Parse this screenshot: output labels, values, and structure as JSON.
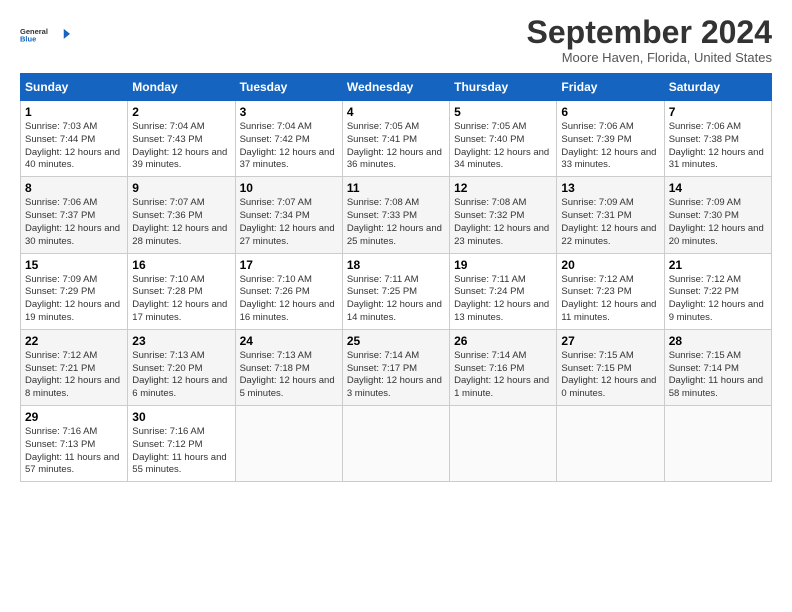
{
  "logo": {
    "line1": "General",
    "line2": "Blue"
  },
  "title": "September 2024",
  "location": "Moore Haven, Florida, United States",
  "weekdays": [
    "Sunday",
    "Monday",
    "Tuesday",
    "Wednesday",
    "Thursday",
    "Friday",
    "Saturday"
  ],
  "weeks": [
    [
      {
        "day": "1",
        "sunrise": "7:03 AM",
        "sunset": "7:44 PM",
        "daylight": "12 hours and 40 minutes."
      },
      {
        "day": "2",
        "sunrise": "7:04 AM",
        "sunset": "7:43 PM",
        "daylight": "12 hours and 39 minutes."
      },
      {
        "day": "3",
        "sunrise": "7:04 AM",
        "sunset": "7:42 PM",
        "daylight": "12 hours and 37 minutes."
      },
      {
        "day": "4",
        "sunrise": "7:05 AM",
        "sunset": "7:41 PM",
        "daylight": "12 hours and 36 minutes."
      },
      {
        "day": "5",
        "sunrise": "7:05 AM",
        "sunset": "7:40 PM",
        "daylight": "12 hours and 34 minutes."
      },
      {
        "day": "6",
        "sunrise": "7:06 AM",
        "sunset": "7:39 PM",
        "daylight": "12 hours and 33 minutes."
      },
      {
        "day": "7",
        "sunrise": "7:06 AM",
        "sunset": "7:38 PM",
        "daylight": "12 hours and 31 minutes."
      }
    ],
    [
      {
        "day": "8",
        "sunrise": "7:06 AM",
        "sunset": "7:37 PM",
        "daylight": "12 hours and 30 minutes."
      },
      {
        "day": "9",
        "sunrise": "7:07 AM",
        "sunset": "7:36 PM",
        "daylight": "12 hours and 28 minutes."
      },
      {
        "day": "10",
        "sunrise": "7:07 AM",
        "sunset": "7:34 PM",
        "daylight": "12 hours and 27 minutes."
      },
      {
        "day": "11",
        "sunrise": "7:08 AM",
        "sunset": "7:33 PM",
        "daylight": "12 hours and 25 minutes."
      },
      {
        "day": "12",
        "sunrise": "7:08 AM",
        "sunset": "7:32 PM",
        "daylight": "12 hours and 23 minutes."
      },
      {
        "day": "13",
        "sunrise": "7:09 AM",
        "sunset": "7:31 PM",
        "daylight": "12 hours and 22 minutes."
      },
      {
        "day": "14",
        "sunrise": "7:09 AM",
        "sunset": "7:30 PM",
        "daylight": "12 hours and 20 minutes."
      }
    ],
    [
      {
        "day": "15",
        "sunrise": "7:09 AM",
        "sunset": "7:29 PM",
        "daylight": "12 hours and 19 minutes."
      },
      {
        "day": "16",
        "sunrise": "7:10 AM",
        "sunset": "7:28 PM",
        "daylight": "12 hours and 17 minutes."
      },
      {
        "day": "17",
        "sunrise": "7:10 AM",
        "sunset": "7:26 PM",
        "daylight": "12 hours and 16 minutes."
      },
      {
        "day": "18",
        "sunrise": "7:11 AM",
        "sunset": "7:25 PM",
        "daylight": "12 hours and 14 minutes."
      },
      {
        "day": "19",
        "sunrise": "7:11 AM",
        "sunset": "7:24 PM",
        "daylight": "12 hours and 13 minutes."
      },
      {
        "day": "20",
        "sunrise": "7:12 AM",
        "sunset": "7:23 PM",
        "daylight": "12 hours and 11 minutes."
      },
      {
        "day": "21",
        "sunrise": "7:12 AM",
        "sunset": "7:22 PM",
        "daylight": "12 hours and 9 minutes."
      }
    ],
    [
      {
        "day": "22",
        "sunrise": "7:12 AM",
        "sunset": "7:21 PM",
        "daylight": "12 hours and 8 minutes."
      },
      {
        "day": "23",
        "sunrise": "7:13 AM",
        "sunset": "7:20 PM",
        "daylight": "12 hours and 6 minutes."
      },
      {
        "day": "24",
        "sunrise": "7:13 AM",
        "sunset": "7:18 PM",
        "daylight": "12 hours and 5 minutes."
      },
      {
        "day": "25",
        "sunrise": "7:14 AM",
        "sunset": "7:17 PM",
        "daylight": "12 hours and 3 minutes."
      },
      {
        "day": "26",
        "sunrise": "7:14 AM",
        "sunset": "7:16 PM",
        "daylight": "12 hours and 1 minute."
      },
      {
        "day": "27",
        "sunrise": "7:15 AM",
        "sunset": "7:15 PM",
        "daylight": "12 hours and 0 minutes."
      },
      {
        "day": "28",
        "sunrise": "7:15 AM",
        "sunset": "7:14 PM",
        "daylight": "11 hours and 58 minutes."
      }
    ],
    [
      {
        "day": "29",
        "sunrise": "7:16 AM",
        "sunset": "7:13 PM",
        "daylight": "11 hours and 57 minutes."
      },
      {
        "day": "30",
        "sunrise": "7:16 AM",
        "sunset": "7:12 PM",
        "daylight": "11 hours and 55 minutes."
      },
      null,
      null,
      null,
      null,
      null
    ]
  ]
}
